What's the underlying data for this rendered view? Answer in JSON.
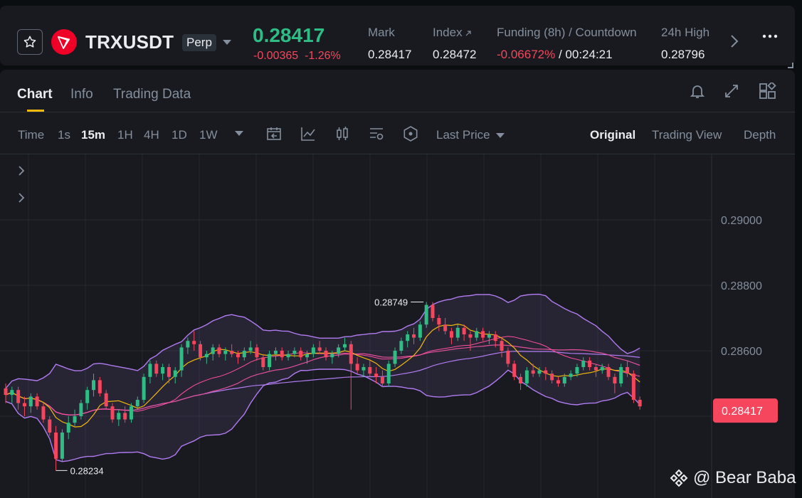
{
  "header": {
    "symbol": "TRXUSDT",
    "contract_type": "Perp",
    "last_price": "0.28417",
    "change_abs": "-0.00365",
    "change_pct": "-1.26%",
    "stats": [
      {
        "label": "Mark",
        "value": "0.28417"
      },
      {
        "label": "Index",
        "value": "0.28472"
      },
      {
        "label": "Funding (8h) / Countdown",
        "value_rate": "-0.06672%",
        "value_countdown": " / 00:24:21"
      },
      {
        "label": "24h High",
        "value": "0.28796"
      }
    ],
    "icons": {
      "favorite": "star-icon",
      "coin": "tron-logo",
      "dropdown": "chevron-down-icon",
      "next": "chevron-right-icon",
      "more": "more-dots-icon"
    }
  },
  "tabs": [
    {
      "label": "Chart",
      "active": true
    },
    {
      "label": "Info",
      "active": false
    },
    {
      "label": "Trading Data",
      "active": false
    }
  ],
  "toolbar": {
    "time_label": "Time",
    "intervals": [
      {
        "label": "1s",
        "active": false
      },
      {
        "label": "15m",
        "active": true
      },
      {
        "label": "1H",
        "active": false
      },
      {
        "label": "4H",
        "active": false
      },
      {
        "label": "1D",
        "active": false
      },
      {
        "label": "1W",
        "active": false
      }
    ],
    "price_type": "Last Price",
    "views": [
      {
        "label": "Original",
        "active": true
      },
      {
        "label": "Trading View",
        "active": false
      },
      {
        "label": "Depth",
        "active": false
      }
    ]
  },
  "colors": {
    "up": "#2ebd85",
    "down": "#f6465d",
    "bg": "#181a20",
    "accent": "#f0b90b",
    "band": "#b07cf0",
    "ma_pink": "#e0509a",
    "ma_yellow": "#f0b90b"
  },
  "chart_data": {
    "type": "candlestick",
    "y_ticks": [
      "0.29000",
      "0.28800",
      "0.28600"
    ],
    "current_price_label": "0.28417",
    "high_label": "0.28749",
    "low_label": "0.28234",
    "candles_ohlc": [
      [
        0.28485,
        0.285,
        0.2844,
        0.28465
      ],
      [
        0.28465,
        0.2849,
        0.2844,
        0.2848
      ],
      [
        0.2848,
        0.2849,
        0.2842,
        0.2844
      ],
      [
        0.2844,
        0.2846,
        0.284,
        0.2843
      ],
      [
        0.2843,
        0.2847,
        0.2841,
        0.2846
      ],
      [
        0.2846,
        0.2847,
        0.2842,
        0.2843
      ],
      [
        0.2843,
        0.2844,
        0.2838,
        0.2839
      ],
      [
        0.2839,
        0.284,
        0.2834,
        0.2835
      ],
      [
        0.2835,
        0.2837,
        0.28234,
        0.2827
      ],
      [
        0.2827,
        0.2836,
        0.2826,
        0.2835
      ],
      [
        0.2835,
        0.284,
        0.2833,
        0.2838
      ],
      [
        0.2838,
        0.2842,
        0.2837,
        0.284
      ],
      [
        0.284,
        0.2845,
        0.2839,
        0.2844
      ],
      [
        0.2844,
        0.2849,
        0.2842,
        0.2848
      ],
      [
        0.2848,
        0.2853,
        0.2846,
        0.2851
      ],
      [
        0.2851,
        0.2852,
        0.2846,
        0.2847
      ],
      [
        0.2847,
        0.2848,
        0.2842,
        0.2843
      ],
      [
        0.2843,
        0.2844,
        0.2838,
        0.2839
      ],
      [
        0.2839,
        0.2842,
        0.2837,
        0.2841
      ],
      [
        0.2841,
        0.2843,
        0.2838,
        0.2839
      ],
      [
        0.2839,
        0.2844,
        0.2838,
        0.2843
      ],
      [
        0.2843,
        0.2846,
        0.2842,
        0.2845
      ],
      [
        0.2845,
        0.2853,
        0.2844,
        0.2852
      ],
      [
        0.2852,
        0.2857,
        0.285,
        0.2856
      ],
      [
        0.2856,
        0.2857,
        0.2852,
        0.2853
      ],
      [
        0.2853,
        0.2856,
        0.2851,
        0.2855
      ],
      [
        0.2855,
        0.2856,
        0.285,
        0.2852
      ],
      [
        0.2852,
        0.2855,
        0.285,
        0.2854
      ],
      [
        0.2854,
        0.2862,
        0.2852,
        0.2861
      ],
      [
        0.2861,
        0.2864,
        0.2859,
        0.2863
      ],
      [
        0.2863,
        0.2866,
        0.286,
        0.2862
      ],
      [
        0.2862,
        0.2863,
        0.2857,
        0.2858
      ],
      [
        0.2858,
        0.286,
        0.2856,
        0.2859
      ],
      [
        0.2859,
        0.2862,
        0.2857,
        0.2861
      ],
      [
        0.2861,
        0.2862,
        0.2858,
        0.2859
      ],
      [
        0.2859,
        0.2861,
        0.2857,
        0.286
      ],
      [
        0.286,
        0.2862,
        0.2858,
        0.2859
      ],
      [
        0.2859,
        0.286,
        0.2856,
        0.2858
      ],
      [
        0.2858,
        0.2861,
        0.2857,
        0.286
      ],
      [
        0.286,
        0.2863,
        0.2859,
        0.2861
      ],
      [
        0.2861,
        0.2862,
        0.2857,
        0.2858
      ],
      [
        0.2858,
        0.2859,
        0.2854,
        0.2855
      ],
      [
        0.2855,
        0.286,
        0.2854,
        0.2859
      ],
      [
        0.2859,
        0.2861,
        0.2857,
        0.286
      ],
      [
        0.286,
        0.2861,
        0.2857,
        0.2858
      ],
      [
        0.2858,
        0.286,
        0.2857,
        0.2859
      ],
      [
        0.2859,
        0.2861,
        0.2858,
        0.286
      ],
      [
        0.286,
        0.2861,
        0.2857,
        0.2858
      ],
      [
        0.2858,
        0.286,
        0.2856,
        0.2859
      ],
      [
        0.2859,
        0.2862,
        0.2858,
        0.2861
      ],
      [
        0.2861,
        0.2863,
        0.2859,
        0.286
      ],
      [
        0.286,
        0.2861,
        0.2857,
        0.2858
      ],
      [
        0.2858,
        0.286,
        0.2856,
        0.2859
      ],
      [
        0.2859,
        0.2862,
        0.2858,
        0.2861
      ],
      [
        0.2861,
        0.2864,
        0.286,
        0.2862
      ],
      [
        0.2862,
        0.2863,
        0.2842,
        0.2856
      ],
      [
        0.2856,
        0.2858,
        0.2853,
        0.2854
      ],
      [
        0.2854,
        0.2856,
        0.2852,
        0.2855
      ],
      [
        0.2855,
        0.2857,
        0.2852,
        0.2853
      ],
      [
        0.2853,
        0.2855,
        0.285,
        0.2852
      ],
      [
        0.2852,
        0.2854,
        0.2849,
        0.285
      ],
      [
        0.285,
        0.2857,
        0.2849,
        0.2856
      ],
      [
        0.2856,
        0.2861,
        0.2855,
        0.286
      ],
      [
        0.286,
        0.2864,
        0.2859,
        0.2863
      ],
      [
        0.2863,
        0.2866,
        0.2861,
        0.2865
      ],
      [
        0.2865,
        0.2867,
        0.2862,
        0.2864
      ],
      [
        0.2864,
        0.2869,
        0.2863,
        0.2868
      ],
      [
        0.2868,
        0.28749,
        0.2867,
        0.2874
      ],
      [
        0.2874,
        0.28749,
        0.2869,
        0.287
      ],
      [
        0.287,
        0.2871,
        0.2866,
        0.2868
      ],
      [
        0.2868,
        0.287,
        0.2865,
        0.2866
      ],
      [
        0.2866,
        0.2867,
        0.2862,
        0.2864
      ],
      [
        0.2864,
        0.2868,
        0.2863,
        0.2867
      ],
      [
        0.2867,
        0.2868,
        0.2863,
        0.2865
      ],
      [
        0.2865,
        0.2866,
        0.286,
        0.2864
      ],
      [
        0.2864,
        0.2867,
        0.2863,
        0.2866
      ],
      [
        0.2866,
        0.2867,
        0.2863,
        0.2864
      ],
      [
        0.2864,
        0.2866,
        0.2862,
        0.2865
      ],
      [
        0.2865,
        0.2866,
        0.2861,
        0.2863
      ],
      [
        0.2863,
        0.2864,
        0.2858,
        0.286
      ],
      [
        0.286,
        0.2861,
        0.2855,
        0.2856
      ],
      [
        0.2856,
        0.2857,
        0.2851,
        0.2852
      ],
      [
        0.2852,
        0.2853,
        0.2848,
        0.285
      ],
      [
        0.285,
        0.2855,
        0.2849,
        0.2854
      ],
      [
        0.2854,
        0.2856,
        0.2852,
        0.2853
      ],
      [
        0.2853,
        0.2855,
        0.2852,
        0.2854
      ],
      [
        0.2854,
        0.2855,
        0.2851,
        0.2853
      ],
      [
        0.2853,
        0.2854,
        0.285,
        0.2851
      ],
      [
        0.2851,
        0.2852,
        0.2849,
        0.285
      ],
      [
        0.285,
        0.2853,
        0.2849,
        0.2852
      ],
      [
        0.2852,
        0.2854,
        0.2851,
        0.2853
      ],
      [
        0.2853,
        0.2856,
        0.2852,
        0.2855
      ],
      [
        0.2855,
        0.2858,
        0.2854,
        0.2857
      ],
      [
        0.2857,
        0.2858,
        0.2854,
        0.2855
      ],
      [
        0.2855,
        0.2856,
        0.2852,
        0.2854
      ],
      [
        0.2854,
        0.2856,
        0.2853,
        0.2855
      ],
      [
        0.2855,
        0.2856,
        0.2851,
        0.2852
      ],
      [
        0.2852,
        0.2853,
        0.2847,
        0.285
      ],
      [
        0.285,
        0.2856,
        0.2849,
        0.2855
      ],
      [
        0.2855,
        0.2857,
        0.2852,
        0.2853
      ],
      [
        0.2853,
        0.2854,
        0.2844,
        0.2845
      ],
      [
        0.2845,
        0.2846,
        0.2842,
        0.2843
      ]
    ]
  },
  "watermark": "@ Bear Baba"
}
